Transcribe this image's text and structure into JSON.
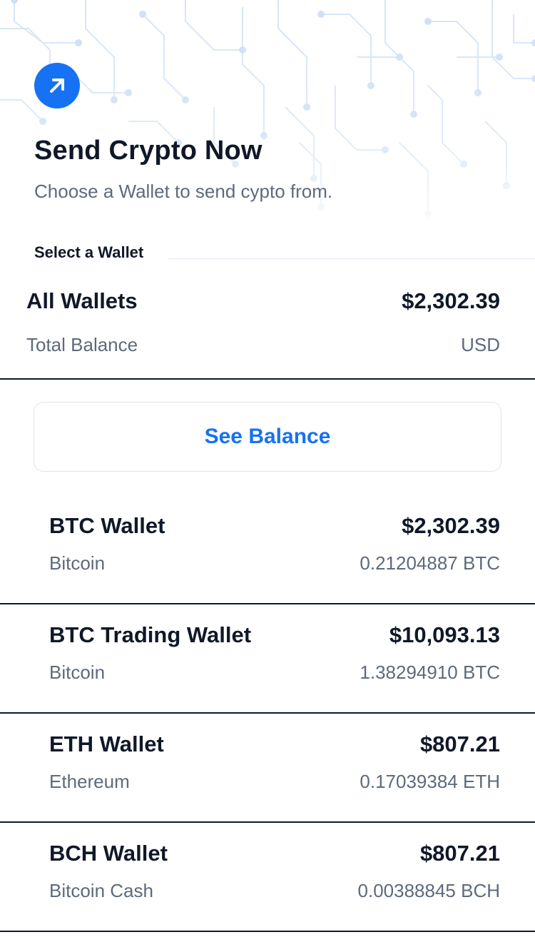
{
  "header": {
    "icon": "arrow-up-right-icon",
    "title": "Send Crypto Now",
    "subtitle": "Choose a Wallet to send cypto from."
  },
  "section_label": "Select a Wallet",
  "all_wallets": {
    "name": "All Wallets",
    "amount": "$2,302.39",
    "label": "Total Balance",
    "currency": "USD"
  },
  "see_balance_label": "See Balance",
  "wallets": [
    {
      "name": "BTC Wallet",
      "usd": "$2,302.39",
      "coin": "Bitcoin",
      "amount": "0.21204887 BTC"
    },
    {
      "name": "BTC Trading Wallet",
      "usd": "$10,093.13",
      "coin": "Bitcoin",
      "amount": "1.38294910 BTC"
    },
    {
      "name": "ETH Wallet",
      "usd": "$807.21",
      "coin": "Ethereum",
      "amount": "0.17039384 ETH"
    },
    {
      "name": "BCH Wallet",
      "usd": "$807.21",
      "coin": "Bitcoin Cash",
      "amount": "0.00388845 BCH"
    }
  ],
  "colors": {
    "accent": "#1672f2",
    "text": "#101828",
    "muted": "#5e6a7b",
    "pattern": "#cfe0f5"
  }
}
